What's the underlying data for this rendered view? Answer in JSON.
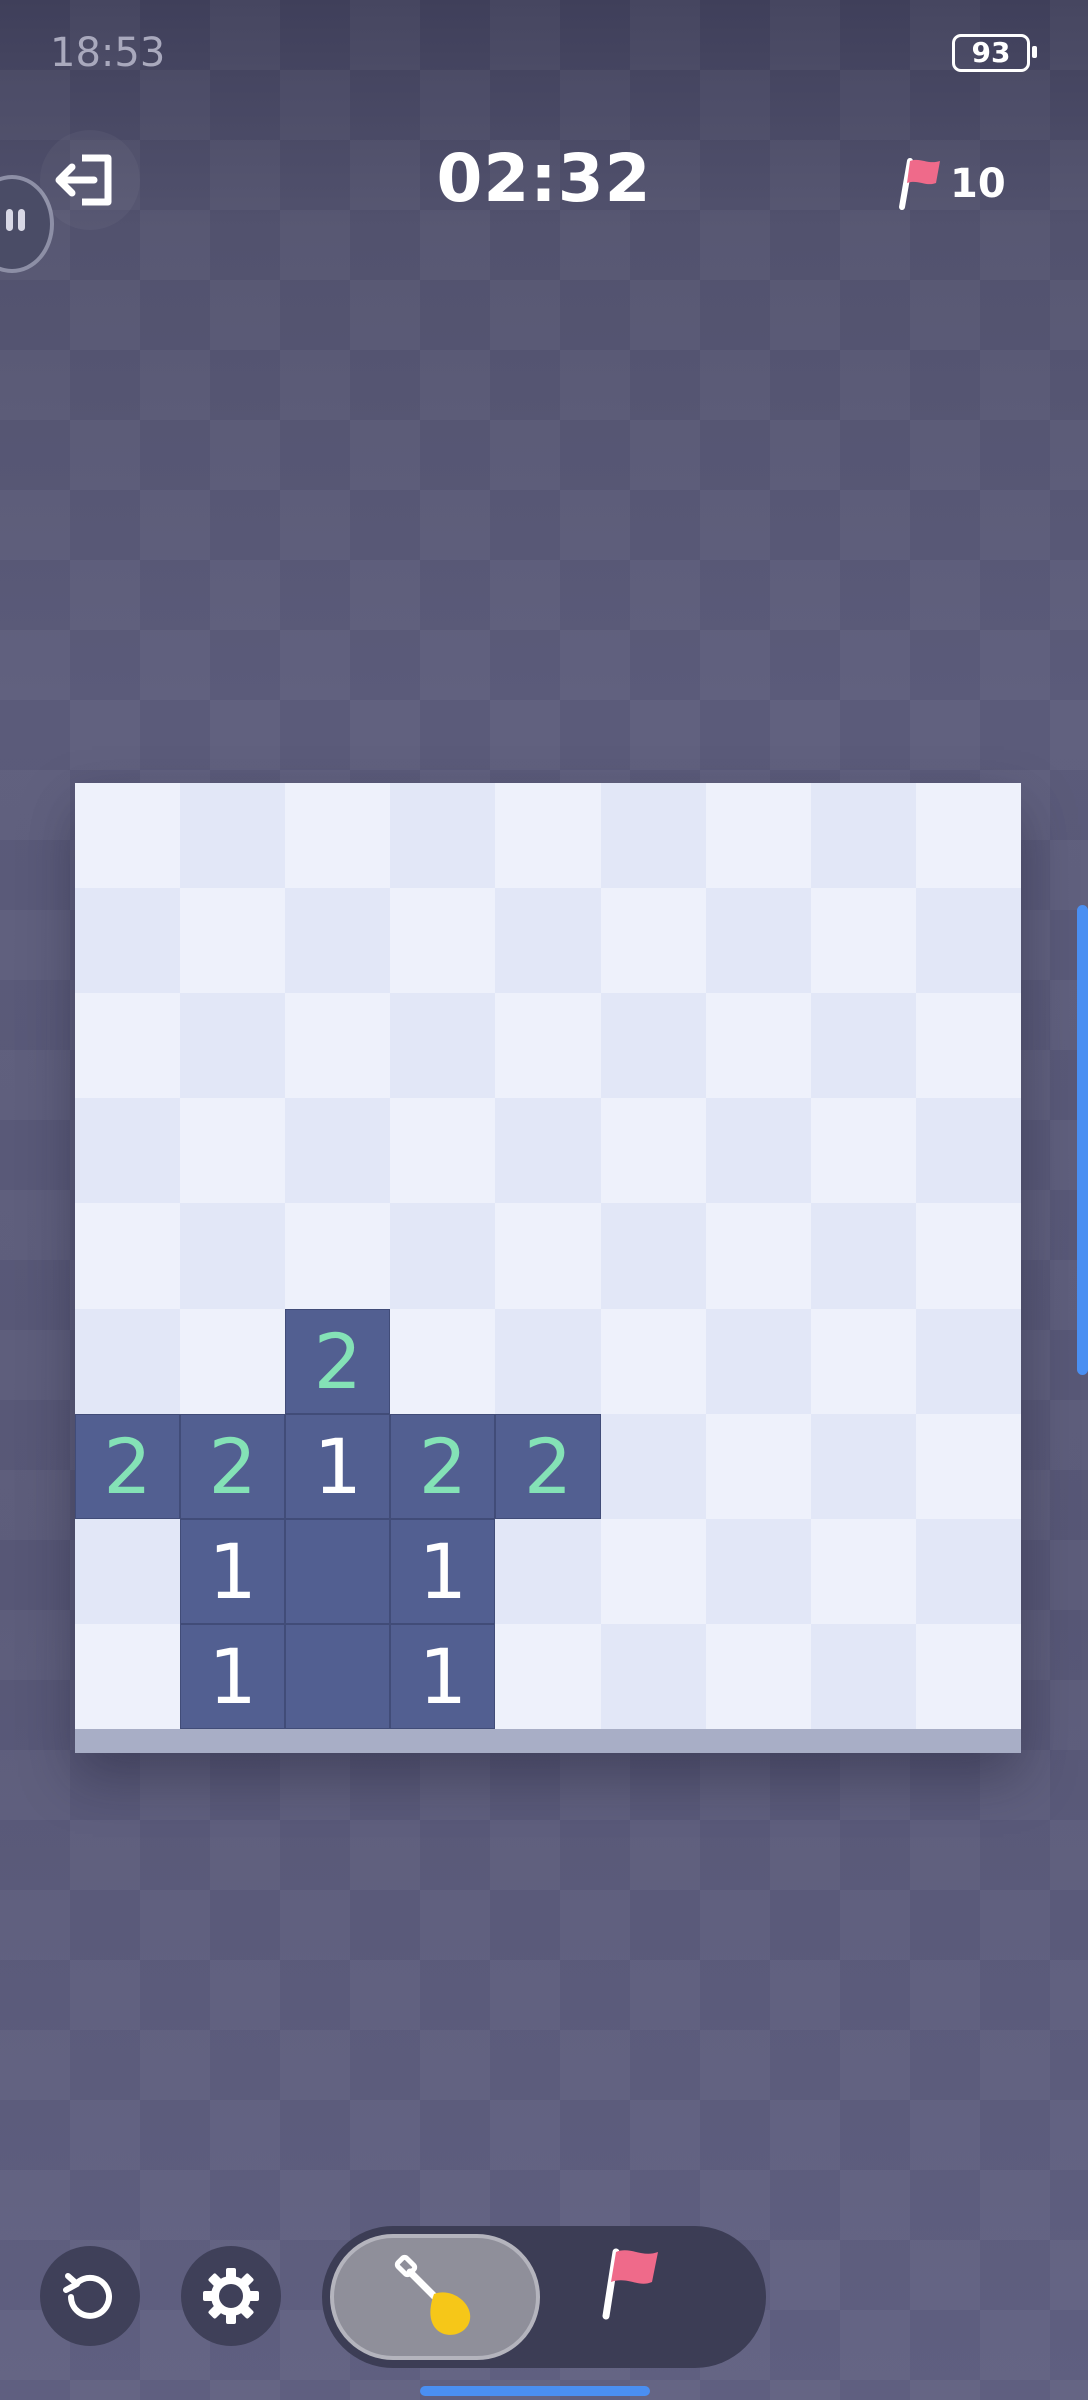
{
  "status_bar": {
    "time": "18:53",
    "battery": "93"
  },
  "header": {
    "timer": "02:32",
    "flags_remaining": "10"
  },
  "icons": {
    "exit": "exit-icon",
    "flag": "flag-icon",
    "restart": "restart-icon",
    "settings": "gear-icon",
    "dig": "shovel-icon"
  },
  "colors": {
    "cell_light": "#eef1fb",
    "cell_dark": "#e2e7f7",
    "cell_open": "#525f91",
    "number_1": "#ffffff",
    "number_2": "#84e2b6",
    "flag": "#ef6a8a",
    "accent": "#4a8ff2"
  },
  "board": {
    "rows": 9,
    "cols": 9,
    "cells": [
      [
        "",
        "",
        "",
        "",
        "",
        "",
        "",
        "",
        ""
      ],
      [
        "",
        "",
        "",
        "",
        "",
        "",
        "",
        "",
        ""
      ],
      [
        "",
        "",
        "",
        "",
        "",
        "",
        "",
        "",
        ""
      ],
      [
        "",
        "",
        "",
        "",
        "",
        "",
        "",
        "",
        ""
      ],
      [
        "",
        "",
        "",
        "",
        "",
        "",
        "",
        "",
        ""
      ],
      [
        "",
        "",
        "2",
        "",
        "",
        "",
        "",
        "",
        ""
      ],
      [
        "2",
        "2",
        "1",
        "2",
        "2",
        "",
        "",
        "",
        ""
      ],
      [
        "",
        "1",
        "0",
        "1",
        "",
        "",
        "",
        "",
        ""
      ],
      [
        "",
        "1",
        "0",
        "1",
        "",
        "",
        "",
        "",
        ""
      ]
    ]
  },
  "controls": {
    "active_mode": "dig"
  }
}
